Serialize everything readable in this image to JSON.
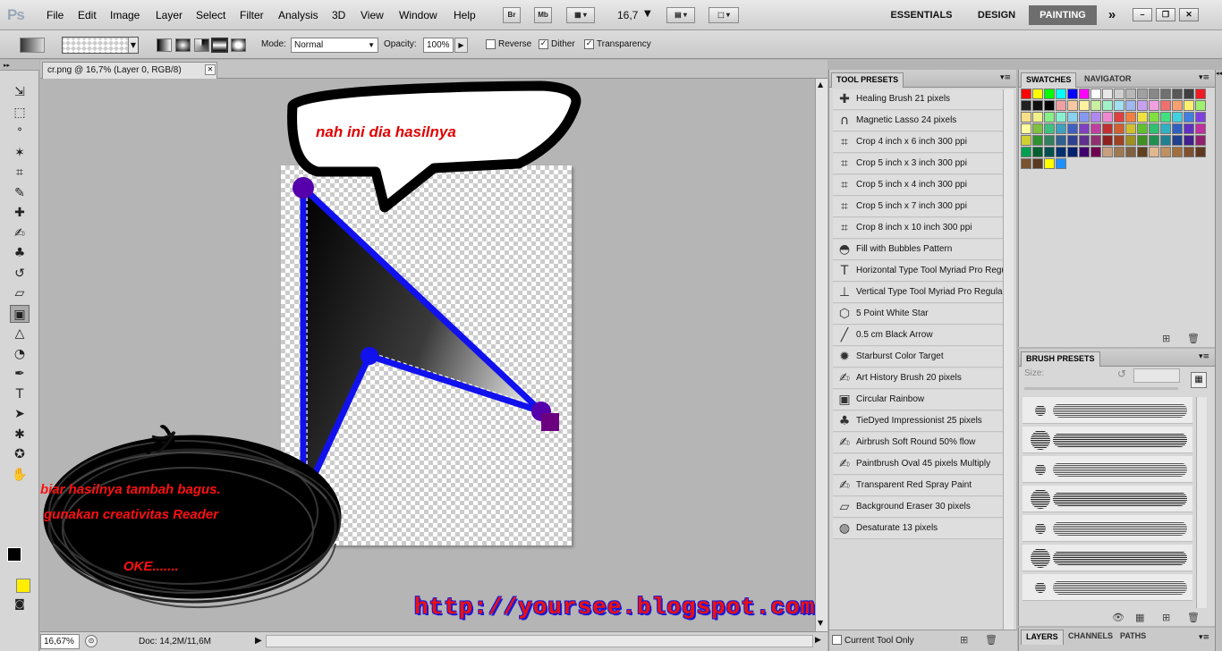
{
  "app": {
    "logo": "Ps"
  },
  "menu": [
    "File",
    "Edit",
    "Image",
    "Layer",
    "Select",
    "Filter",
    "Analysis",
    "3D",
    "View",
    "Window",
    "Help"
  ],
  "appbar": {
    "bridge": "Br",
    "mini": "Mb",
    "zoom": "16,7"
  },
  "workspaces": {
    "essentials": "ESSENTIALS",
    "design": "DESIGN",
    "painting": "PAINTING",
    "more": "»"
  },
  "window_controls": {
    "minimize": "–",
    "restore": "❐",
    "close": "✕"
  },
  "options": {
    "mode_label": "Mode:",
    "mode_value": "Normal",
    "opacity_label": "Opacity:",
    "opacity_value": "100%",
    "reverse_label": "Reverse",
    "reverse_checked": "",
    "dither_label": "Dither",
    "dither_checked": "✓",
    "transparency_label": "Transparency",
    "transparency_checked": "✓"
  },
  "tools": [
    {
      "name": "move-tool",
      "glyph": "⇲"
    },
    {
      "name": "marquee-tool",
      "glyph": "⬚"
    },
    {
      "name": "lasso-tool",
      "glyph": "ᐤ"
    },
    {
      "name": "quick-select-tool",
      "glyph": "✶"
    },
    {
      "name": "crop-tool",
      "glyph": "⌗"
    },
    {
      "name": "eyedropper-tool",
      "glyph": "✎"
    },
    {
      "name": "healing-tool",
      "glyph": "✚"
    },
    {
      "name": "brush-tool",
      "glyph": "✍"
    },
    {
      "name": "clone-stamp-tool",
      "glyph": "♣"
    },
    {
      "name": "history-brush-tool",
      "glyph": "↺"
    },
    {
      "name": "eraser-tool",
      "glyph": "▱"
    },
    {
      "name": "gradient-tool",
      "glyph": "▣"
    },
    {
      "name": "blur-tool",
      "glyph": "△"
    },
    {
      "name": "dodge-tool",
      "glyph": "◔"
    },
    {
      "name": "pen-tool",
      "glyph": "✒"
    },
    {
      "name": "type-tool",
      "glyph": "T"
    },
    {
      "name": "path-select-tool",
      "glyph": "➤"
    },
    {
      "name": "shape-tool",
      "glyph": "✱"
    },
    {
      "name": "3d-rotate-tool",
      "glyph": "✪"
    },
    {
      "name": "hand-tool",
      "glyph": "✋"
    }
  ],
  "document": {
    "tab_title": "cr.png @ 16,7% (Layer 0, RGB/8)",
    "tab_close": "✕",
    "zoom": "16,67%",
    "doc_info": "Doc: 14,2M/11,6M",
    "bubble_text": "nah ini dia hasilnya",
    "scribble_line1": "biar hasilnya tambah bagus.",
    "scribble_line2": "gunakan creativitas Reader",
    "scribble_line3": "OKE.......",
    "url": "http://yoursee.blogspot.com"
  },
  "tool_presets": {
    "title": "TOOL PRESETS",
    "items": [
      {
        "label": "Healing Brush 21 pixels",
        "icon": "bandage-icon",
        "glyph": "✚"
      },
      {
        "label": "Magnetic Lasso 24 pixels",
        "icon": "magnet-icon",
        "glyph": "∩"
      },
      {
        "label": "Crop 4 inch x 6 inch 300 ppi",
        "icon": "crop-icon",
        "glyph": "⌗"
      },
      {
        "label": "Crop 5 inch x 3 inch 300 ppi",
        "icon": "crop-icon",
        "glyph": "⌗"
      },
      {
        "label": "Crop 5 inch x 4 inch 300 ppi",
        "icon": "crop-icon",
        "glyph": "⌗"
      },
      {
        "label": "Crop 5 inch x 7 inch 300 ppi",
        "icon": "crop-icon",
        "glyph": "⌗"
      },
      {
        "label": "Crop 8 inch x 10 inch 300 ppi",
        "icon": "crop-icon",
        "glyph": "⌗"
      },
      {
        "label": "Fill with Bubbles Pattern",
        "icon": "paint-bucket-icon",
        "glyph": "◓"
      },
      {
        "label": "Horizontal Type Tool Myriad Pro Regular",
        "icon": "type-icon",
        "glyph": "T"
      },
      {
        "label": "Vertical Type Tool Myriad Pro Regular",
        "icon": "vertical-type-icon",
        "glyph": "⊥"
      },
      {
        "label": "5 Point White Star",
        "icon": "polygon-icon",
        "glyph": "⬡"
      },
      {
        "label": "0.5 cm Black Arrow",
        "icon": "line-icon",
        "glyph": "╱"
      },
      {
        "label": "Starburst Color Target",
        "icon": "starburst-icon",
        "glyph": "✹"
      },
      {
        "label": "Art History Brush 20 pixels",
        "icon": "art-history-icon",
        "glyph": "✍"
      },
      {
        "label": "Circular Rainbow",
        "icon": "gradient-icon",
        "glyph": "▣"
      },
      {
        "label": "TieDyed Impressionist 25 pixels",
        "icon": "pattern-stamp-icon",
        "glyph": "♣"
      },
      {
        "label": "Airbrush Soft Round 50% flow",
        "icon": "airbrush-icon",
        "glyph": "✍"
      },
      {
        "label": "Paintbrush Oval 45 pixels Multiply",
        "icon": "paintbrush-icon",
        "glyph": "✍"
      },
      {
        "label": "Transparent Red Spray Paint",
        "icon": "spray-icon",
        "glyph": "✍"
      },
      {
        "label": "Background Eraser 30 pixels",
        "icon": "bg-eraser-icon",
        "glyph": "▱"
      },
      {
        "label": "Desaturate 13 pixels",
        "icon": "sponge-icon",
        "glyph": "◍"
      }
    ],
    "current_tool_only": "Current Tool Only"
  },
  "swatches": {
    "tabs": [
      "SWATCHES",
      "NAVIGATOR"
    ],
    "colors": [
      "#ff0000",
      "#ffff00",
      "#00ff00",
      "#00ffff",
      "#0000ff",
      "#ff00ff",
      "#ffffff",
      "#e8e8e8",
      "#d0d0d0",
      "#b8b8b8",
      "#a0a0a0",
      "#888888",
      "#707070",
      "#585858",
      "#404040",
      "#ee1c24",
      "#202020",
      "#101010",
      "#000000",
      "#f0a0a0",
      "#f8c8a0",
      "#fff0a0",
      "#c8f0a0",
      "#a0f0c8",
      "#a0e0f0",
      "#a0b8f0",
      "#c8a0f0",
      "#f0a0e0",
      "#f07070",
      "#f8a070",
      "#fff070",
      "#a0f070",
      "#f8e088",
      "#f0f088",
      "#88f088",
      "#88f0d0",
      "#88d0f0",
      "#8898f0",
      "#b088f0",
      "#f088d0",
      "#e04040",
      "#f08040",
      "#f0e040",
      "#80e040",
      "#40e080",
      "#40d0e0",
      "#4080e0",
      "#8040e0",
      "#ffffa0",
      "#80c040",
      "#40c080",
      "#40a0c0",
      "#4060c0",
      "#8040c0",
      "#c040a0",
      "#c03030",
      "#d06030",
      "#d0c030",
      "#60c030",
      "#30c070",
      "#30b0c0",
      "#3060c0",
      "#6030c0",
      "#c030a0",
      "#d0d030",
      "#309030",
      "#308060",
      "#306090",
      "#304090",
      "#603090",
      "#903070",
      "#902020",
      "#a04020",
      "#a09020",
      "#409020",
      "#209050",
      "#208090",
      "#204090",
      "#402090",
      "#902070",
      "#00a050",
      "#006030",
      "#005050",
      "#003070",
      "#002070",
      "#400070",
      "#700050",
      "#c8a080",
      "#a07850",
      "#806040",
      "#604020",
      "#e0b890",
      "#c09060",
      "#a07040",
      "#805030",
      "#603820",
      "#7a5230",
      "#5a3a20",
      "#ffff00",
      "#1e90ff"
    ]
  },
  "brush_presets": {
    "title": "BRUSH PRESETS",
    "size_label": "Size:",
    "rows": 7
  },
  "layers": {
    "tabs": [
      "LAYERS",
      "CHANNELS",
      "PATHS"
    ]
  }
}
